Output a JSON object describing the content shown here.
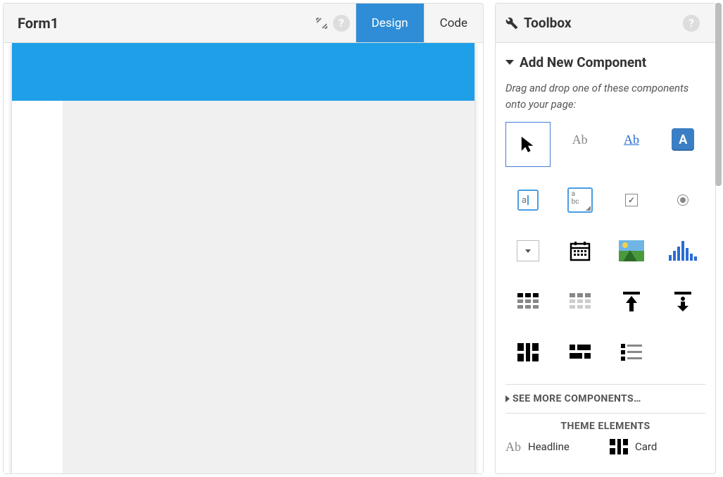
{
  "left": {
    "form_title": "Form1",
    "tabs": {
      "design": "Design",
      "code": "Code"
    },
    "active_tab": "design"
  },
  "toolbox": {
    "title": "Toolbox",
    "add_section": {
      "heading": "Add New Component",
      "description": "Drag and drop one of these components onto your page:"
    },
    "components": [
      {
        "id": "pointer",
        "name": "pointer",
        "selected": true
      },
      {
        "id": "label",
        "name": "label",
        "glyph": "Ab"
      },
      {
        "id": "link",
        "name": "link",
        "glyph": "Ab"
      },
      {
        "id": "button",
        "name": "button",
        "glyph": "A"
      },
      {
        "id": "textbox",
        "name": "textbox",
        "glyph": "a"
      },
      {
        "id": "textarea",
        "name": "textarea",
        "glyph": "a\nbc"
      },
      {
        "id": "checkbox",
        "name": "checkbox"
      },
      {
        "id": "radio",
        "name": "radio"
      },
      {
        "id": "dropdown",
        "name": "dropdown"
      },
      {
        "id": "datepicker",
        "name": "datepicker"
      },
      {
        "id": "image",
        "name": "image"
      },
      {
        "id": "chart",
        "name": "chart"
      },
      {
        "id": "datagrid",
        "name": "data-grid"
      },
      {
        "id": "repeating",
        "name": "repeating-panel"
      },
      {
        "id": "fileuploader",
        "name": "file-uploader"
      },
      {
        "id": "download",
        "name": "download"
      },
      {
        "id": "columnpanel",
        "name": "column-panel"
      },
      {
        "id": "flowpanel",
        "name": "flow-panel"
      },
      {
        "id": "richtext",
        "name": "rich-text"
      }
    ],
    "see_more": "SEE MORE COMPONENTS…",
    "theme_header": "THEME ELEMENTS",
    "theme_elements": [
      {
        "id": "headline",
        "label": "Headline"
      },
      {
        "id": "card",
        "label": "Card"
      }
    ]
  }
}
